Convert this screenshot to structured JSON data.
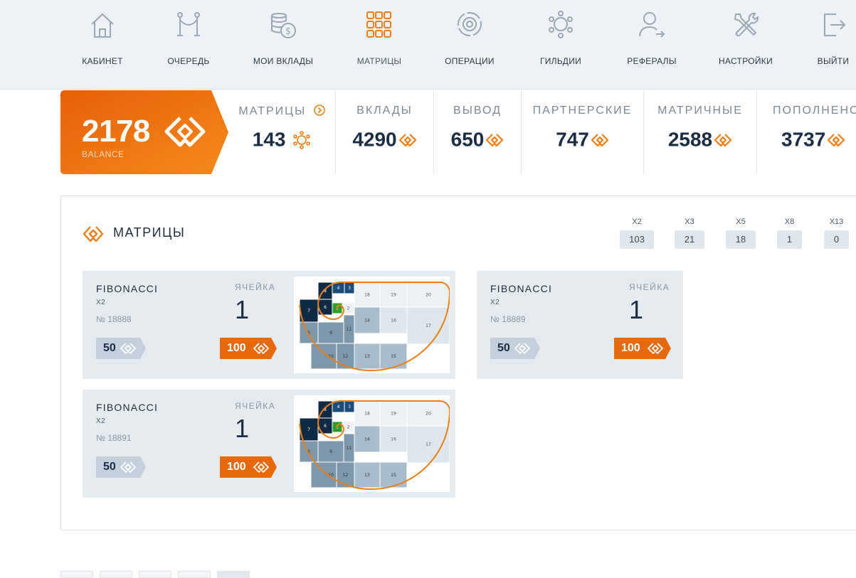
{
  "nav": {
    "items": [
      {
        "label": "КАБИНЕТ",
        "icon": "home-icon"
      },
      {
        "label": "ОЧЕРЕДЬ",
        "icon": "queue-rope-icon"
      },
      {
        "label": "МОИ ВКЛАДЫ",
        "icon": "coins-icon"
      },
      {
        "label": "МАТРИЦЫ",
        "icon": "matrix-grid-icon"
      },
      {
        "label": "ОПЕРАЦИИ",
        "icon": "operations-cycle-icon"
      },
      {
        "label": "ГИЛЬДИИ",
        "icon": "guild-network-icon"
      },
      {
        "label": "РЕФЕРАЛЫ",
        "icon": "referral-user-icon"
      },
      {
        "label": "НАСТРОЙКИ",
        "icon": "settings-tools-icon"
      },
      {
        "label": "ВЫЙТИ",
        "icon": "logout-icon"
      }
    ],
    "active_index": 3
  },
  "balance": {
    "value": "2178",
    "label": "BALANCE"
  },
  "stats": [
    {
      "title": "МАТРИЦЫ",
      "value": "143",
      "icon": "matrix-network-icon"
    },
    {
      "title": "ВКЛАДЫ",
      "value": "4290",
      "icon": "coin-logo-icon"
    },
    {
      "title": "ВЫВОД",
      "value": "650",
      "icon": "coin-logo-icon"
    },
    {
      "title": "ПАРТНЕРСКИЕ",
      "value": "747",
      "icon": "coin-logo-icon"
    },
    {
      "title": "МАТРИЧНЫЕ",
      "value": "2588",
      "icon": "coin-logo-icon"
    },
    {
      "title": "ПОПОЛНЕНО",
      "value": "3737",
      "icon": "coin-logo-icon"
    }
  ],
  "panel": {
    "title": "МАТРИЦЫ",
    "multipliers": [
      {
        "label": "X2",
        "value": "103"
      },
      {
        "label": "X3",
        "value": "21"
      },
      {
        "label": "X5",
        "value": "18"
      },
      {
        "label": "X8",
        "value": "1"
      },
      {
        "label": "X13",
        "value": "0"
      }
    ]
  },
  "cards": [
    {
      "name": "FIBONACCI",
      "sub": "X2",
      "number": "№ 18888",
      "cell_label": "ЯЧЕЙКА",
      "cell": "1",
      "price_grey": "50",
      "price_orange": "100",
      "has_thumb": true
    },
    {
      "name": "FIBONACCI",
      "sub": "X2",
      "number": "№ 18889",
      "cell_label": "ЯЧЕЙКА",
      "cell": "1",
      "price_grey": "50",
      "price_orange": "100",
      "has_thumb": false
    },
    {
      "name": "FIBONACCI",
      "sub": "X2",
      "number": "№ 18891",
      "cell_label": "ЯЧЕЙКА",
      "cell": "1",
      "price_grey": "50",
      "price_orange": "100",
      "has_thumb": true
    }
  ],
  "thumb_cells": [
    "8",
    "4",
    "3",
    "18",
    "19",
    "20",
    "7",
    "6",
    "1",
    "2",
    "14",
    "16",
    "17",
    "5",
    "9",
    "11",
    "10",
    "12",
    "13",
    "15"
  ],
  "colors": {
    "accent": "#f07c14",
    "navy": "#1b2d45",
    "card_bg": "#e6ebf0"
  }
}
